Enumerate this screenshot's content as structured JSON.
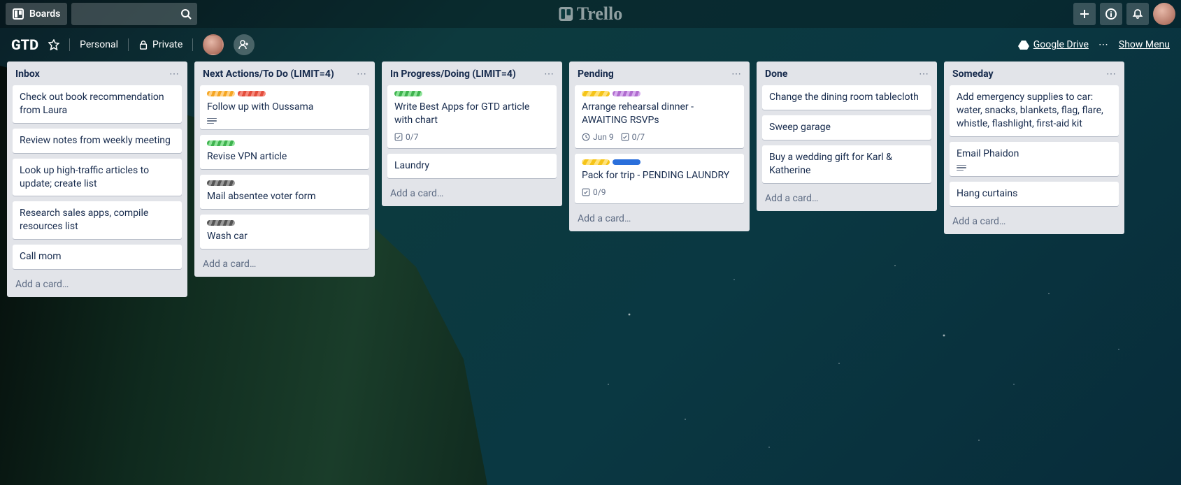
{
  "header": {
    "boards_label": "Boards",
    "logo_text": "Trello"
  },
  "board_header": {
    "name": "GTD",
    "team": "Personal",
    "visibility": "Private",
    "drive": "Google Drive",
    "show_menu": "Show Menu"
  },
  "lists": [
    {
      "title": "Inbox",
      "cards": [
        {
          "text": "Check out book recommendation from Laura"
        },
        {
          "text": "Review notes from weekly meeting"
        },
        {
          "text": "Look up high-traffic articles to update; create list"
        },
        {
          "text": "Research sales apps, compile resources list"
        },
        {
          "text": "Call mom"
        }
      ],
      "add": "Add a card…"
    },
    {
      "title": "Next Actions/To Do (LIMIT=4)",
      "cards": [
        {
          "labels": [
            "orange-st",
            "red-st"
          ],
          "text": "Follow up with Oussama",
          "desc": true
        },
        {
          "labels": [
            "green-st"
          ],
          "text": "Revise VPN article"
        },
        {
          "labels": [
            "gray-st"
          ],
          "text": "Mail absentee voter form"
        },
        {
          "labels": [
            "gray-st"
          ],
          "text": "Wash car"
        }
      ],
      "add": "Add a card…"
    },
    {
      "title": "In Progress/Doing (LIMIT=4)",
      "cards": [
        {
          "labels": [
            "green-st"
          ],
          "text": "Write Best Apps for GTD article with chart",
          "checklist": "0/7"
        },
        {
          "text": "Laundry"
        }
      ],
      "add": "Add a card…"
    },
    {
      "title": "Pending",
      "cards": [
        {
          "labels": [
            "yellow-sc",
            "purple-st"
          ],
          "text": "Arrange rehearsal dinner - AWAITING RSVPs",
          "due": "Jun 9",
          "checklist": "0/7"
        },
        {
          "labels": [
            "yellow-sc",
            "blue-solid"
          ],
          "text": "Pack for trip - PENDING LAUNDRY",
          "checklist": "0/9"
        }
      ],
      "add": "Add a card…"
    },
    {
      "title": "Done",
      "cards": [
        {
          "text": "Change the dining room tablecloth"
        },
        {
          "text": "Sweep garage"
        },
        {
          "text": "Buy a wedding gift for Karl & Katherine"
        }
      ],
      "add": "Add a card…"
    },
    {
      "title": "Someday",
      "cards": [
        {
          "text": "Add emergency supplies to car: water, snacks, blankets, flag, flare, whistle, flashlight, first-aid kit"
        },
        {
          "text": "Email Phaidon",
          "desc": true
        },
        {
          "text": "Hang curtains"
        }
      ],
      "add": "Add a card…"
    }
  ]
}
